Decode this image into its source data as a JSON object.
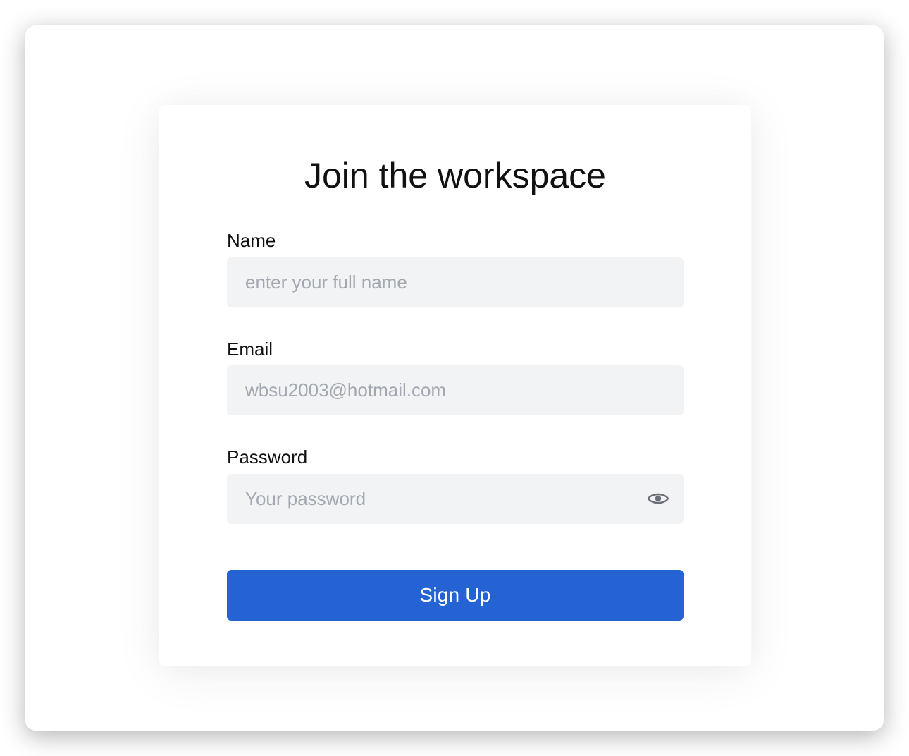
{
  "form": {
    "title": "Join the workspace",
    "name": {
      "label": "Name",
      "placeholder": "enter your full name",
      "value": ""
    },
    "email": {
      "label": "Email",
      "placeholder": "wbsu2003@hotmail.com",
      "value": ""
    },
    "password": {
      "label": "Password",
      "placeholder": "Your password",
      "value": "",
      "toggle_icon": "eye-icon"
    },
    "submit_label": "Sign Up"
  },
  "colors": {
    "primary": "#2563d4",
    "field_background": "#f2f3f5",
    "placeholder": "#a3a8b0",
    "text": "#111111"
  }
}
